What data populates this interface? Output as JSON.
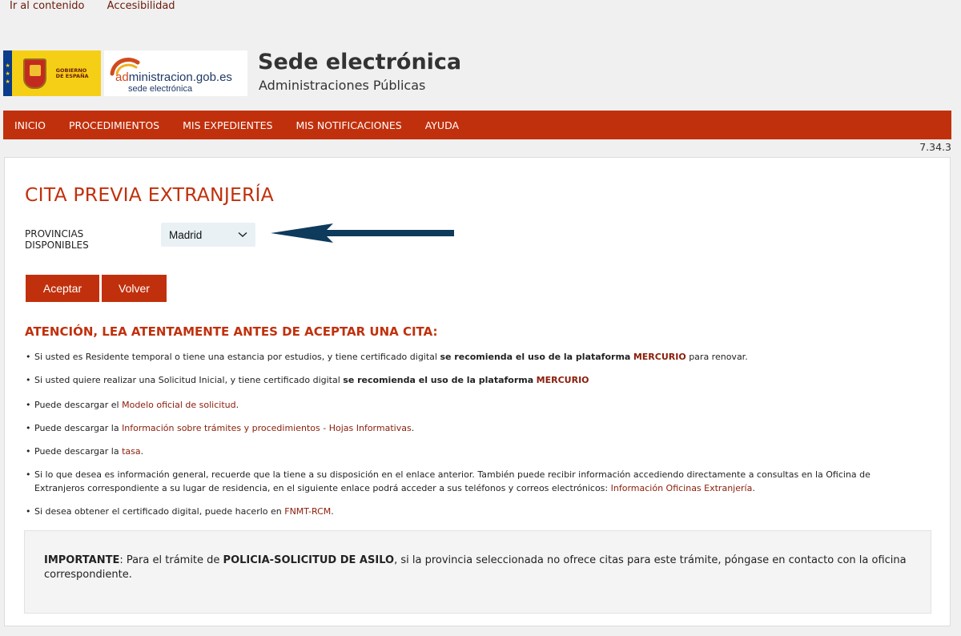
{
  "skip_links": {
    "content": "Ir al contenido",
    "accessibility": "Accesibilidad"
  },
  "header": {
    "gov_logo_text_1": "GOBIERNO",
    "gov_logo_text_2": "DE ESPAÑA",
    "adm_logo_name_a": "ad",
    "adm_logo_name_b": "ministracion.gob.es",
    "adm_logo_sub": "sede electrónica",
    "title": "Sede electrónica",
    "subtitle": "Administraciones Públicas"
  },
  "nav": {
    "items": [
      {
        "label": "INICIO"
      },
      {
        "label": "PROCEDIMIENTOS"
      },
      {
        "label": "MIS EXPEDIENTES"
      },
      {
        "label": "MIS NOTIFICACIONES"
      },
      {
        "label": "AYUDA"
      }
    ]
  },
  "version": "7.34.3",
  "main": {
    "title": "CITA PREVIA EXTRANJERÍA",
    "province_label_1": "PROVINCIAS",
    "province_label_2": "DISPONIBLES",
    "province_selected": "Madrid",
    "accept_label": "Aceptar",
    "back_label": "Volver",
    "notice_heading": "ATENCIÓN, LEA ATENTAMENTE ANTES DE ACEPTAR UNA CITA:",
    "bullets": {
      "b1_pre": "Si usted es Residente temporal o tiene una estancia por estudios, y tiene certificado digital ",
      "b1_bold": "se recomienda el uso de la plataforma",
      "b1_link": "MERCURIO",
      "b1_post": " para renovar.",
      "b2_pre": "Si usted quiere realizar una Solicitud Inicial, y tiene certificado digital ",
      "b2_bold": "se recomienda el uso de la plataforma",
      "b2_link": "MERCURIO",
      "b3_pre": "Puede descargar el ",
      "b3_link": "Modelo oficial de solicitud",
      "b3_post": ".",
      "b4_pre": "Puede descargar la ",
      "b4_link": "Información sobre trámites y procedimientos - Hojas Informativas",
      "b4_post": ".",
      "b5_pre": "Puede descargar la ",
      "b5_link": "tasa",
      "b5_post": ".",
      "b6_pre": "Si lo que desea es información general, recuerde que la tiene a su disposición en el enlace anterior. También puede recibir información accediendo directamente a consultas en la Oficina de Extranjeros correspondiente a su lugar de residencia, en el siguiente enlace podrá acceder a sus teléfonos y correos electrónicos: ",
      "b6_link": "Información Oficinas Extranjería",
      "b6_post": ".",
      "b7_pre": "Si desea obtener el certificado digital, puede hacerlo en ",
      "b7_link": "FNMT-RCM",
      "b7_post": "."
    },
    "important": {
      "label": "IMPORTANTE",
      "text_1": ": Para el trámite de ",
      "bold": "POLICIA-SOLICITUD DE ASILO",
      "text_2": ", si la provincia seleccionada no ofrece citas para este trámite, póngase en contacto con la oficina correspondiente."
    }
  },
  "colors": {
    "brand_red": "#c1300c",
    "link_dark_red": "#8a1c08",
    "arrow_navy": "#0e3a5c",
    "gov_yellow": "#f5cf15"
  }
}
